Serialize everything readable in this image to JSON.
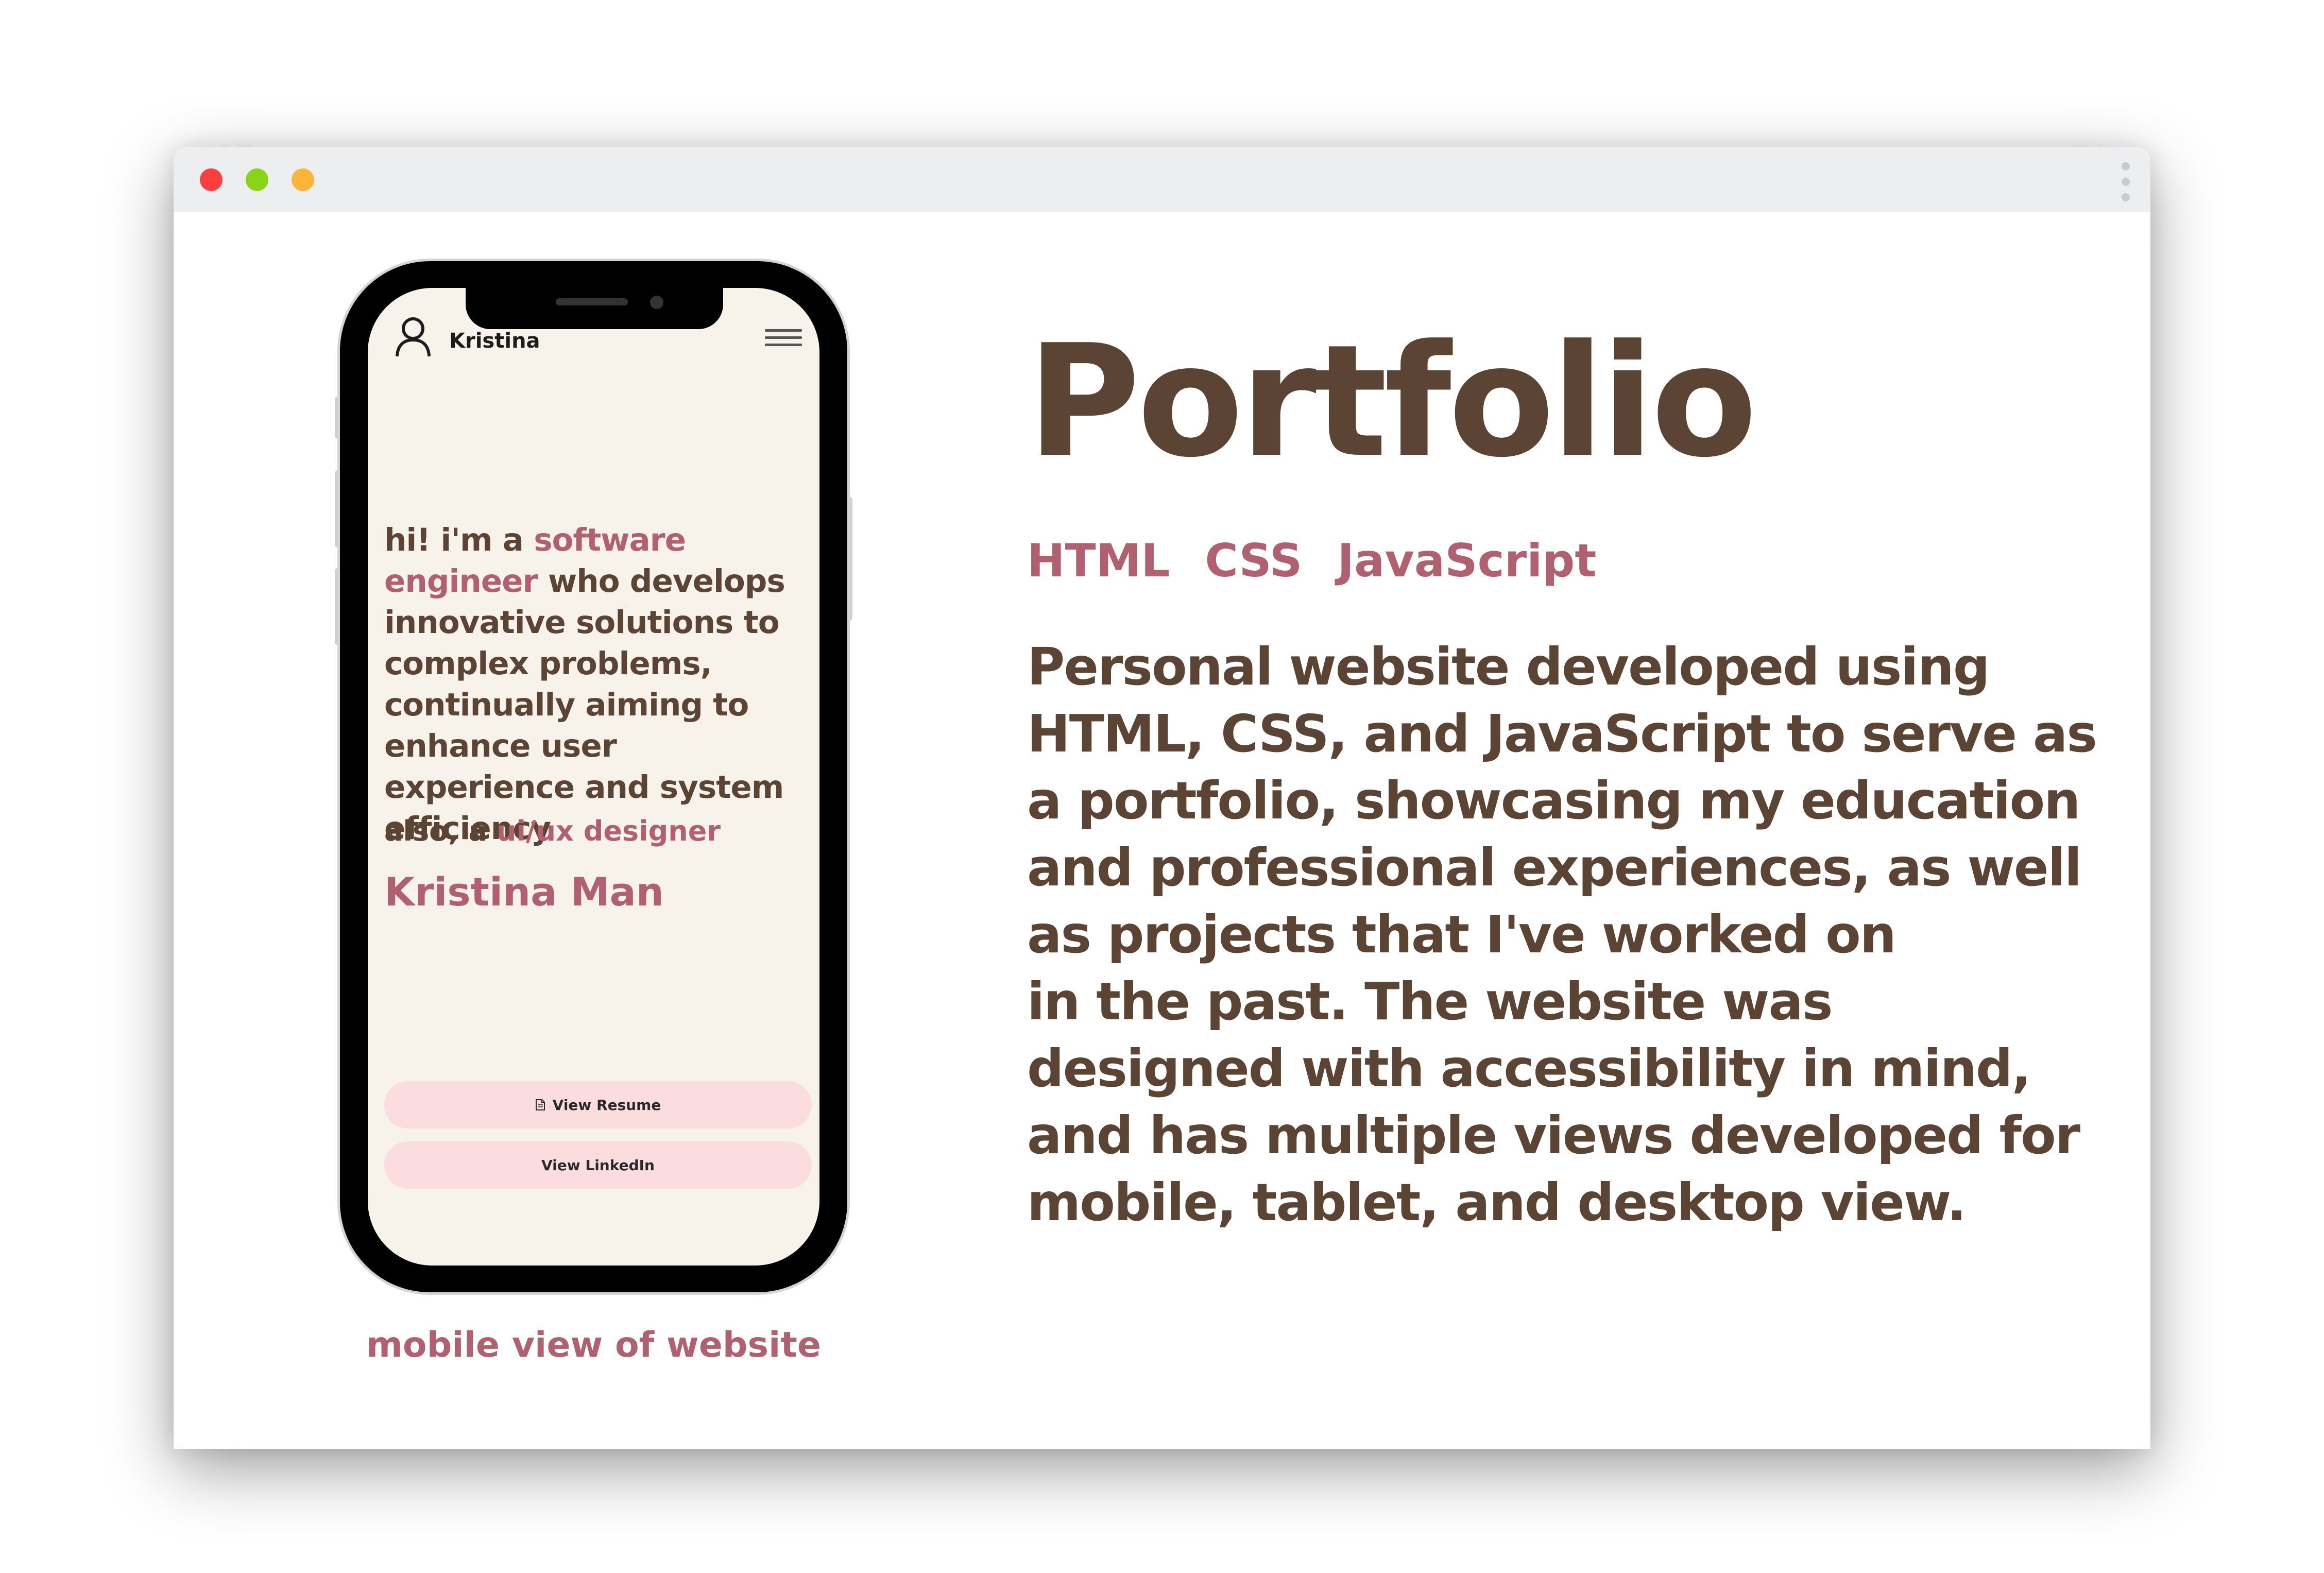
{
  "window": {
    "colors": {
      "accent": "#b0606e",
      "text": "#5b4434",
      "screen_bg": "#f7f2ea",
      "button_bg": "#fbdcdf"
    }
  },
  "phone": {
    "brand": "Kristina",
    "intro_prefix": "hi! i'm a ",
    "intro_role": "software engineer",
    "intro_rest": " who develops innovative solutions to complex problems, continually aiming to enhance user experience and system efficiency",
    "also_label": "also, a",
    "also_role": "ui/ux designer",
    "name": "Kristina Man",
    "resume_button": "View Resume",
    "linkedin_button": "View LinkedIn",
    "icons": {
      "user": "user-icon",
      "menu": "hamburger-icon",
      "resume": "document-icon"
    }
  },
  "caption": "mobile view of website",
  "project": {
    "title": "Portfolio",
    "tags": [
      "HTML",
      "CSS",
      "JavaScript"
    ],
    "description": "Personal website developed using HTML, CSS, and JavaScript to serve as a portfolio, showcasing my education and professional experiences, as well as projects that I've worked on\n in the past. The website was designed with accessibility in mind, and has multiple views developed for mobile, tablet, and desktop view."
  }
}
